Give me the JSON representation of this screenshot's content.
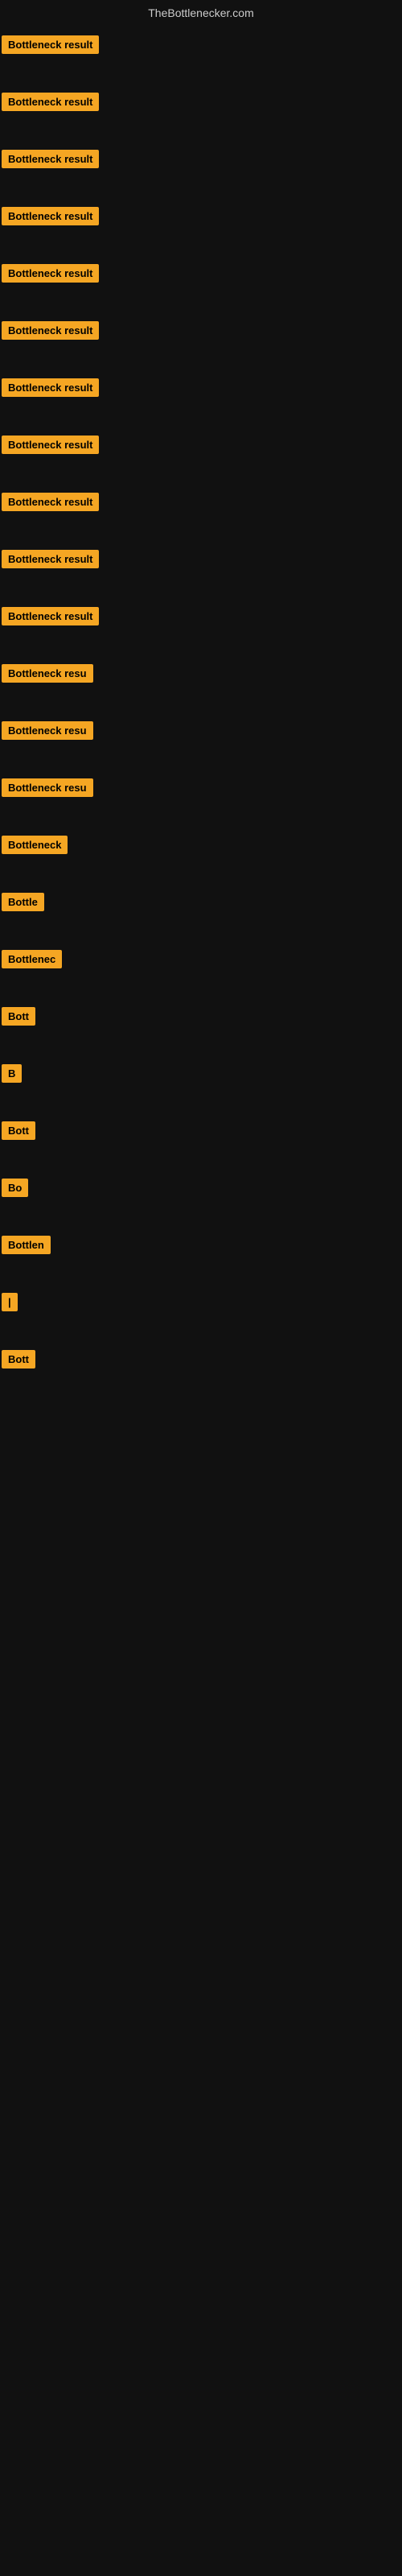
{
  "header": {
    "title": "TheBottlenecker.com"
  },
  "colors": {
    "background": "#111111",
    "badge_bg": "#f5a623",
    "badge_text": "#000000",
    "header_text": "#cccccc"
  },
  "items": [
    {
      "id": 1,
      "label": "Bottleneck result"
    },
    {
      "id": 2,
      "label": "Bottleneck result"
    },
    {
      "id": 3,
      "label": "Bottleneck result"
    },
    {
      "id": 4,
      "label": "Bottleneck result"
    },
    {
      "id": 5,
      "label": "Bottleneck result"
    },
    {
      "id": 6,
      "label": "Bottleneck result"
    },
    {
      "id": 7,
      "label": "Bottleneck result"
    },
    {
      "id": 8,
      "label": "Bottleneck result"
    },
    {
      "id": 9,
      "label": "Bottleneck result"
    },
    {
      "id": 10,
      "label": "Bottleneck result"
    },
    {
      "id": 11,
      "label": "Bottleneck result"
    },
    {
      "id": 12,
      "label": "Bottleneck resu"
    },
    {
      "id": 13,
      "label": "Bottleneck resu"
    },
    {
      "id": 14,
      "label": "Bottleneck resu"
    },
    {
      "id": 15,
      "label": "Bottleneck"
    },
    {
      "id": 16,
      "label": "Bottle"
    },
    {
      "id": 17,
      "label": "Bottlenec"
    },
    {
      "id": 18,
      "label": "Bott"
    },
    {
      "id": 19,
      "label": "B"
    },
    {
      "id": 20,
      "label": "Bott"
    },
    {
      "id": 21,
      "label": "Bo"
    },
    {
      "id": 22,
      "label": "Bottlen"
    },
    {
      "id": 23,
      "label": "|"
    },
    {
      "id": 24,
      "label": "Bott"
    },
    {
      "id": 25,
      "label": ""
    }
  ]
}
